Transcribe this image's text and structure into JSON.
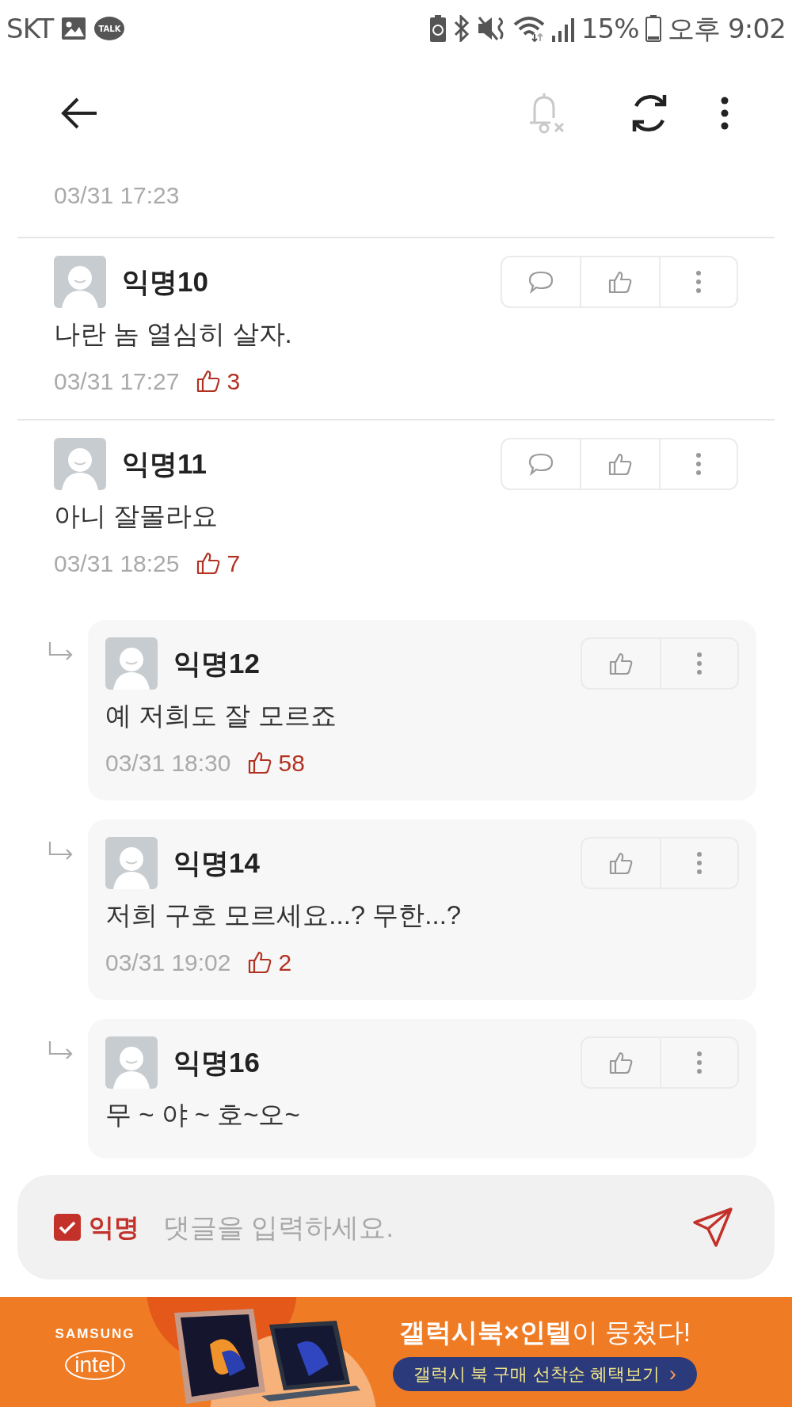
{
  "status_bar": {
    "carrier": "SKT",
    "talk_badge": "TALK",
    "battery": "15%",
    "time": "오후 9:02"
  },
  "toolbar": {
    "notifications_disabled": true
  },
  "post": {
    "time": "03/31 17:23"
  },
  "comments": [
    {
      "kind": "comment",
      "author": "익명10",
      "text": "나란 놈 열심히 살자.",
      "time": "03/31 17:27",
      "likes": "3"
    },
    {
      "kind": "comment",
      "author": "익명11",
      "text": "아니 잘몰라요",
      "time": "03/31 18:25",
      "likes": "7"
    },
    {
      "kind": "reply",
      "author": "익명12",
      "text": "예 저희도 잘 모르죠",
      "time": "03/31 18:30",
      "likes": "58"
    },
    {
      "kind": "reply",
      "author": "익명14",
      "text": "저희 구호 모르세요...? 무한...?",
      "time": "03/31 19:02",
      "likes": "2"
    },
    {
      "kind": "reply",
      "author": "익명16",
      "text": "무 ~ 야 ~ 호~오~"
    }
  ],
  "composer": {
    "anonymous": {
      "label": "익명",
      "checked": true
    },
    "placeholder": "댓글을 입력하세요."
  },
  "ad": {
    "brand_1": "SAMSUNG",
    "brand_2": "intel",
    "headline_bold": "갤럭시북×인텔",
    "headline_rest": "이 뭉쳤다!",
    "cta": "갤럭시 북 구매 선착순 혜택보기",
    "cta_arrow": "›"
  }
}
